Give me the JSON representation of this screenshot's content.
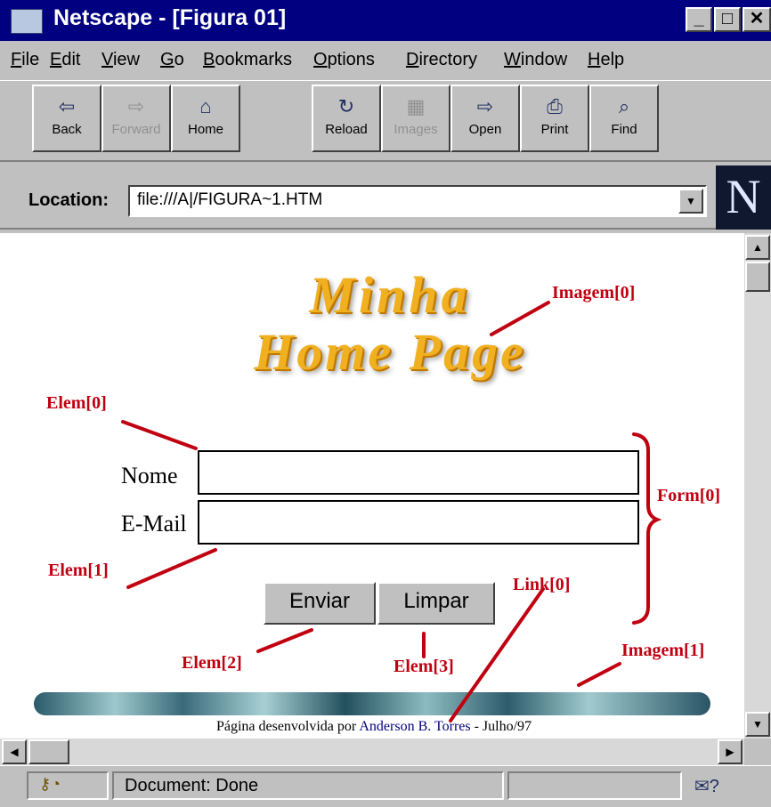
{
  "window": {
    "title": "Netscape - [Figura 01]",
    "minimize": "_",
    "maximize": "□",
    "close": "✕"
  },
  "menu": [
    "File",
    "Edit",
    "View",
    "Go",
    "Bookmarks",
    "Options",
    "Directory",
    "Window",
    "Help"
  ],
  "toolbar": {
    "back": "Back",
    "forward": "Forward",
    "home": "Home",
    "reload": "Reload",
    "images": "Images",
    "open": "Open",
    "print": "Print",
    "find": "Find"
  },
  "location": {
    "label": "Location:",
    "url": "file:///A|/FIGURA~1.HTM",
    "logo": "N"
  },
  "page": {
    "logo_line1": "Minha",
    "logo_line2": "Home Page",
    "label_nome": "Nome",
    "label_email": "E-Mail",
    "button_enviar": "Enviar",
    "button_limpar": "Limpar",
    "footer_prefix": "Página desenvolvida por ",
    "footer_link": "Anderson B. Torres",
    "footer_suffix": " - Julho/97"
  },
  "annotations": {
    "imagem0": "Imagem[0]",
    "elem0": "Elem[0]",
    "elem1": "Elem[1]",
    "elem2": "Elem[2]",
    "elem3": "Elem[3]",
    "form0": "Form[0]",
    "link0": "Link[0]",
    "imagem1": "Imagem[1]"
  },
  "status": {
    "text": "Document: Done"
  },
  "colors": {
    "titlebar": "#000080",
    "annotation": "#c00010",
    "chrome": "#c0c0c0"
  }
}
